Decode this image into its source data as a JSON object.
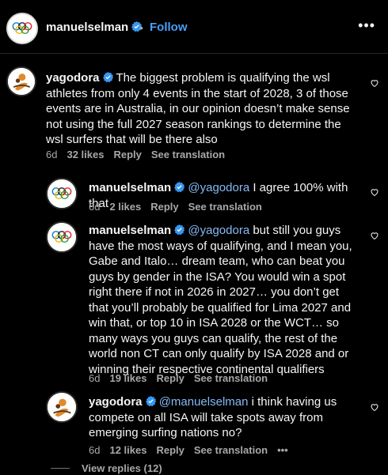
{
  "header": {
    "username": "manuelselman",
    "dot": "•",
    "follow_label": "Follow",
    "more_label": "•••"
  },
  "comments": [
    {
      "username": "yagodora",
      "text": "The biggest problem is qualifying the wsl athletes from only 4 events in the start of 2028, 3 of those events are in Australia, in our opinion doesn’t make sense not using the full 2027 season rankings to determine the wsl surfers that will be there also",
      "time": "6d",
      "likes": "32 likes",
      "reply": "Reply",
      "translate": "See translation"
    },
    {
      "username": "manuelselman",
      "mention": "@yagodora",
      "text": "I agree 100% with that",
      "time": "6d",
      "likes": "2 likes",
      "reply": "Reply",
      "translate": "See translation"
    },
    {
      "username": "manuelselman",
      "mention": "@yagodora",
      "text": "but still you guys have the most ways of qualifying, and I mean you, Gabe and Italo… dream team, who can beat you guys by gender in the ISA? You would win a spot right there if not in 2026 in 2027… you don’t get that you’ll probably be qualified for Lima 2027 and win that, or top 10 in ISA 2028 or the WCT… so many ways you guys can qualify, the rest of the world non CT can only qualify by ISA 2028 and or winning their respective continental qualifiers",
      "time": "6d",
      "likes": "19 likes",
      "reply": "Reply",
      "translate": "See translation"
    },
    {
      "username": "yagodora",
      "mention": "@manuelselman",
      "text": "i think having us compete on all ISA will take spots away from emerging surfing nations no?",
      "time": "6d",
      "likes": "12 likes",
      "reply": "Reply",
      "translate": "See translation",
      "more": "•••"
    }
  ],
  "view_replies": "View replies (12)",
  "colors": {
    "background": "#000000",
    "link": "#4a9df8",
    "mention": "#86b9f5",
    "muted": "#a8a8a8",
    "verified": "#3897f0"
  }
}
